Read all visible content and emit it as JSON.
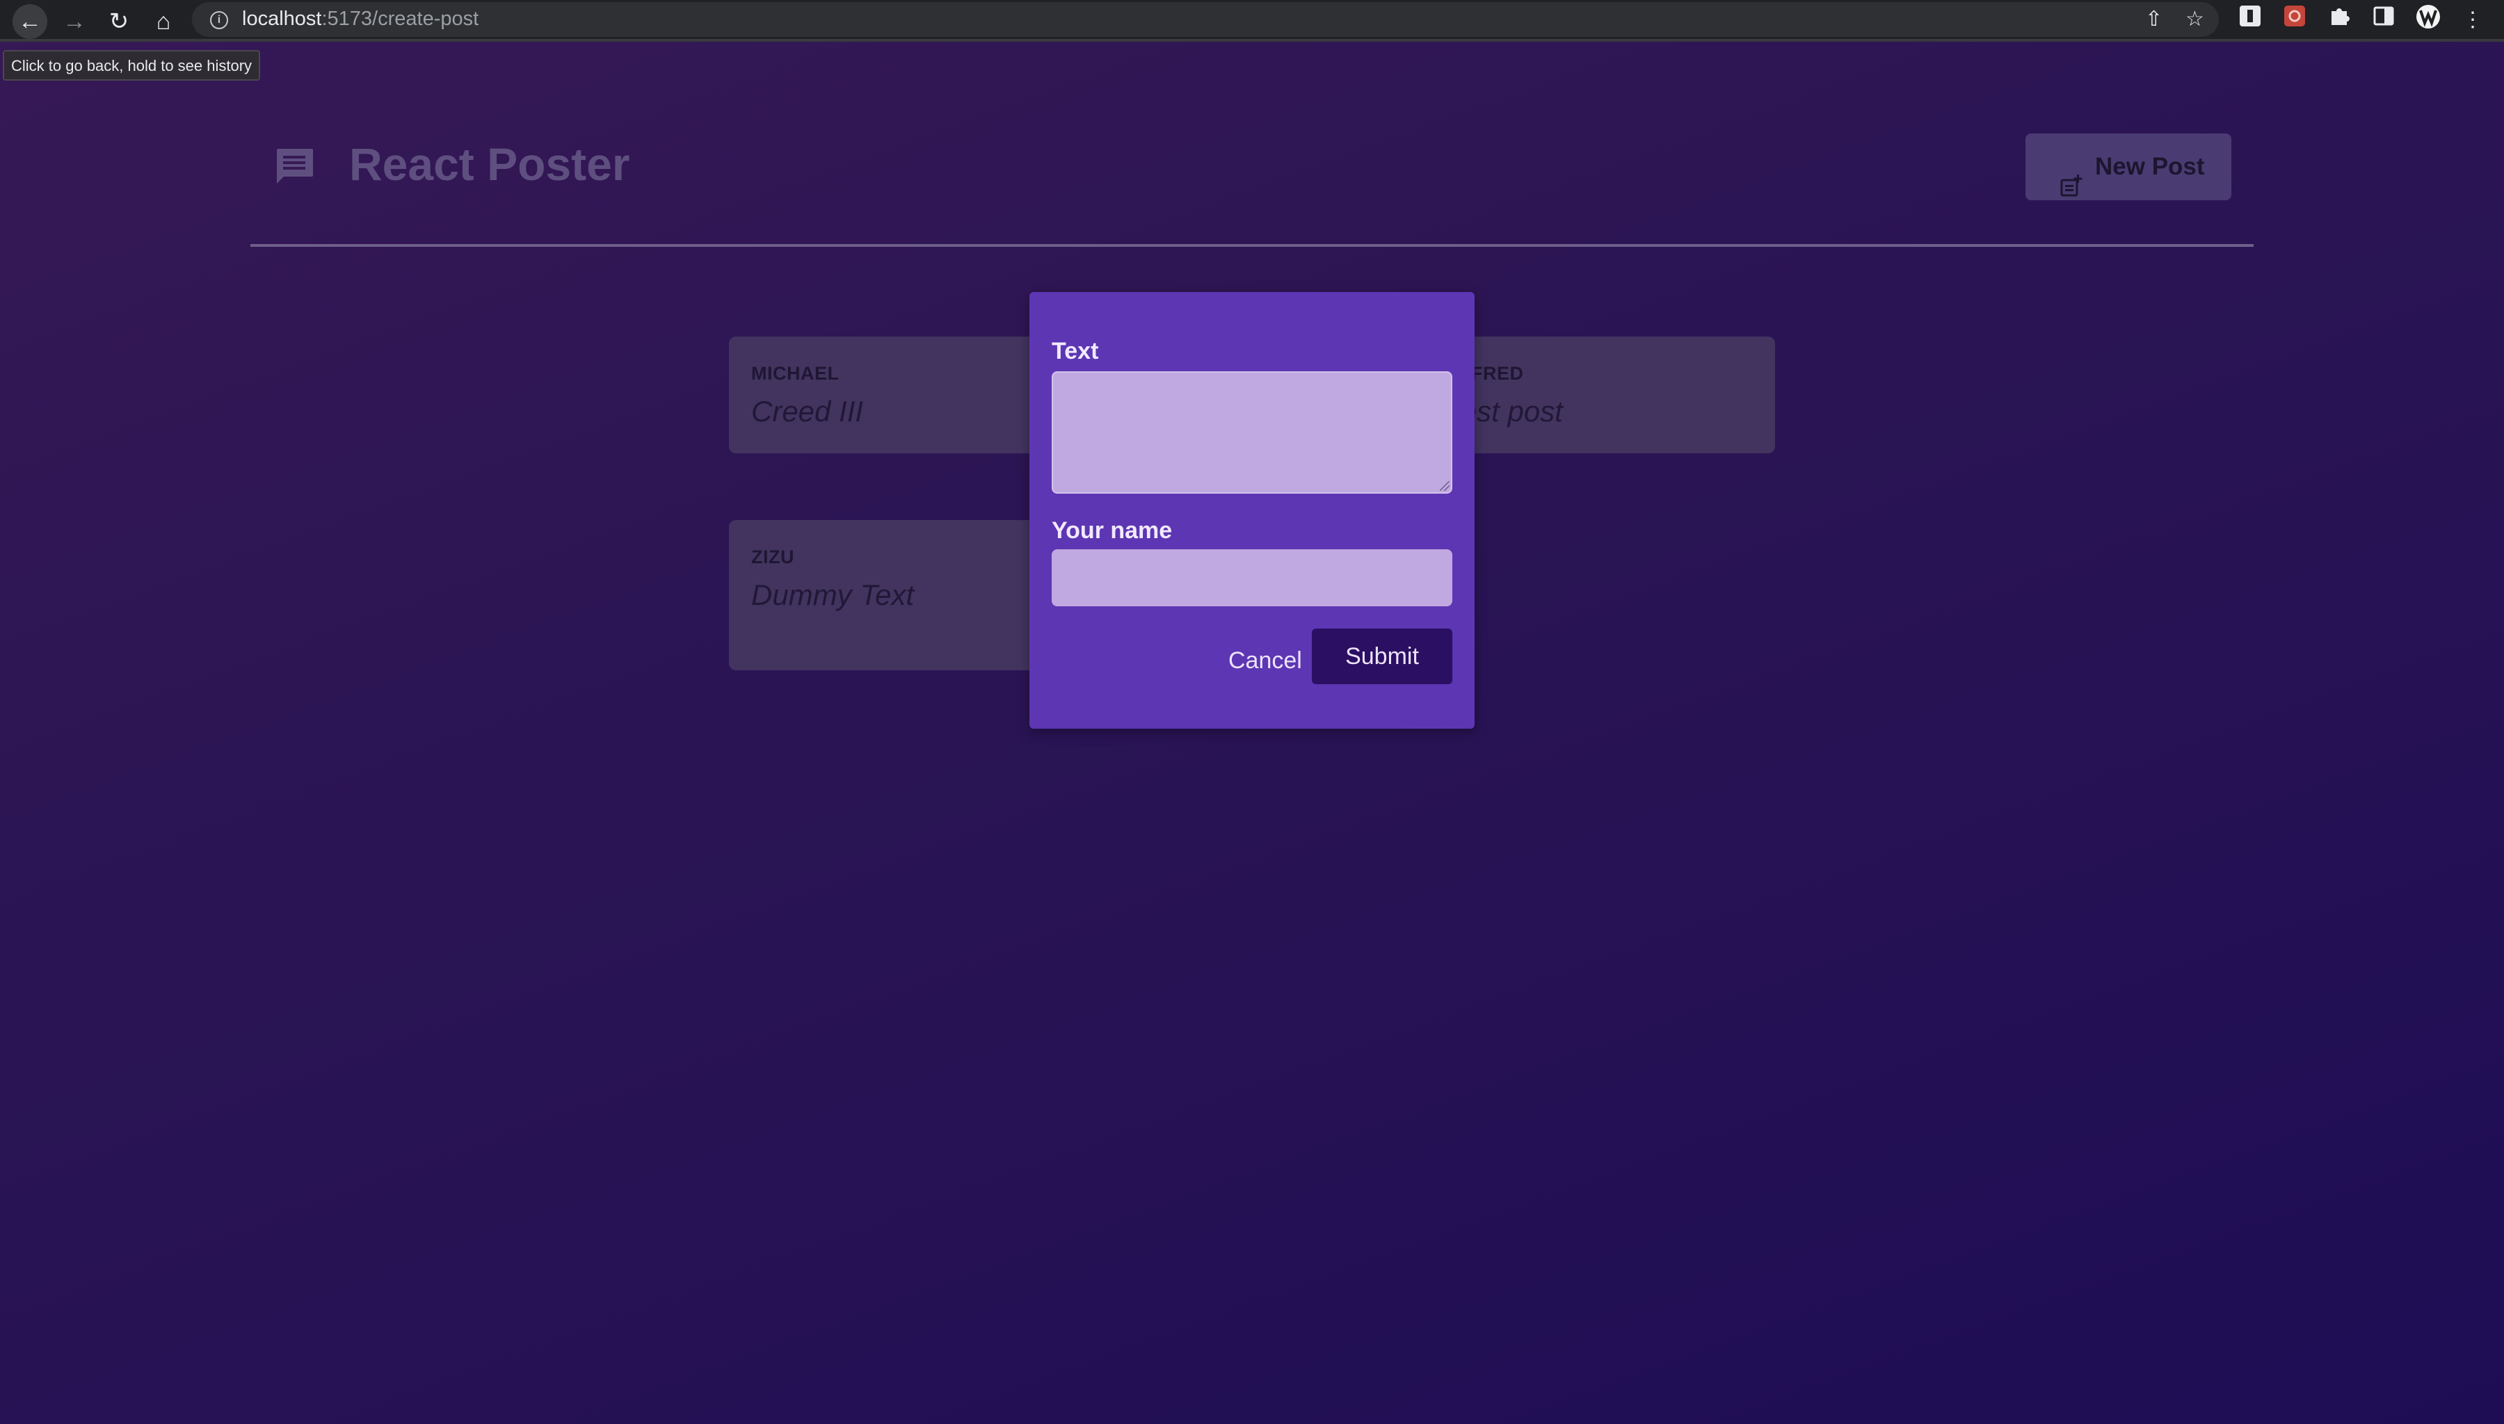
{
  "browser": {
    "url_host": "localhost",
    "url_path": ":5173/create-post",
    "tooltip": "Click to go back, hold to see history"
  },
  "header": {
    "title": "React Poster",
    "new_post_label": "New Post"
  },
  "posts": [
    {
      "author": "MICHAEL",
      "body": "Creed III"
    },
    {
      "author": "ALFRED",
      "body": "Test post"
    },
    {
      "author": "ZIZU",
      "body": "Dummy Text"
    }
  ],
  "modal": {
    "text_label": "Text",
    "text_value": "",
    "name_label": "Your name",
    "name_value": "",
    "cancel_label": "Cancel",
    "submit_label": "Submit"
  },
  "colors": {
    "background_top": "#361955",
    "background_bottom": "#1e0d55",
    "modal_bg": "#5d36b3",
    "input_bg": "#c0a9e0",
    "submit_bg": "#2b0f62",
    "post_card_bg": "#42345f"
  }
}
